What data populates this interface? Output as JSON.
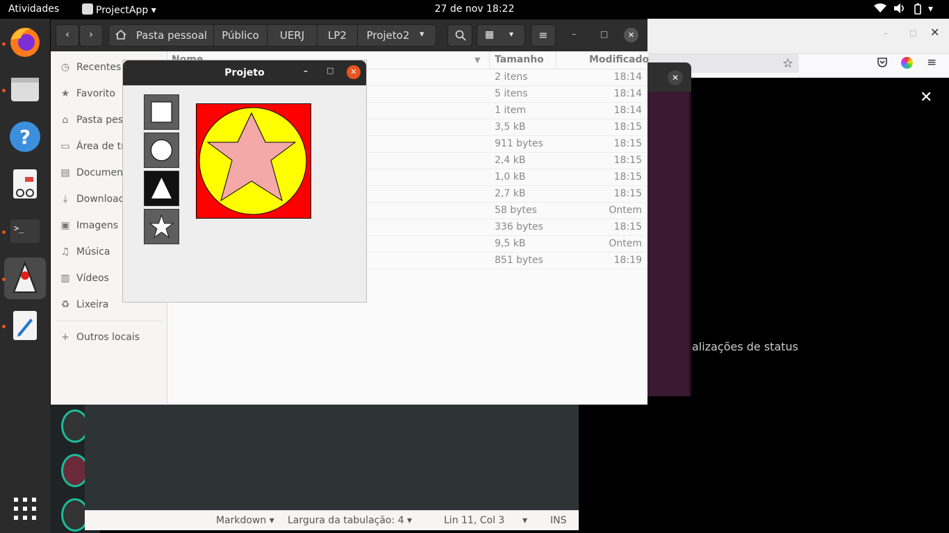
{
  "topbar": {
    "activities": "Atividades",
    "app_name": "ProjectApp",
    "clock": "27 de nov  18:22"
  },
  "file_manager": {
    "breadcrumbs": [
      "Pasta pessoal",
      "Público",
      "UERJ",
      "LP2",
      "Projeto2"
    ],
    "sidebar": [
      {
        "label": "Recentes",
        "icon": "clock-icon"
      },
      {
        "label": "Favorito",
        "icon": "star-icon"
      },
      {
        "label": "Pasta pes",
        "icon": "home-icon"
      },
      {
        "label": "Área de tr",
        "icon": "desktop-icon"
      },
      {
        "label": "Documen",
        "icon": "document-icon"
      },
      {
        "label": "Download",
        "icon": "download-icon"
      },
      {
        "label": "Imagens",
        "icon": "image-icon"
      },
      {
        "label": "Música",
        "icon": "music-icon"
      },
      {
        "label": "Vídeos",
        "icon": "video-icon"
      },
      {
        "label": "Lixeira",
        "icon": "trash-icon"
      },
      {
        "label": "Outros locais",
        "icon": "plus-icon"
      }
    ],
    "columns": {
      "name": "Nome",
      "size": "Tamanho",
      "modified": "Modificado"
    },
    "rows": [
      {
        "size": "2 itens",
        "modified": "18:14"
      },
      {
        "size": "5 itens",
        "modified": "18:14"
      },
      {
        "size": "1 item",
        "modified": "18:14"
      },
      {
        "size": "3,5 kB",
        "modified": "18:15"
      },
      {
        "size": "911 bytes",
        "modified": "18:15"
      },
      {
        "size": "2,4 kB",
        "modified": "18:15"
      },
      {
        "size": "1,0 kB",
        "modified": "18:15"
      },
      {
        "size": "2,7 kB",
        "modified": "18:15"
      },
      {
        "size": "58 bytes",
        "modified": "Ontem"
      },
      {
        "size": "336 bytes",
        "modified": "18:15"
      },
      {
        "size": "9,5 kB",
        "modified": "Ontem"
      },
      {
        "size": "851 bytes",
        "modified": "18:19"
      }
    ]
  },
  "projeto_window": {
    "title": "Projeto",
    "tools": [
      "square-tool",
      "circle-tool",
      "triangle-tool",
      "star-tool"
    ],
    "canvas_colors": {
      "background": "#ff0000",
      "circle": "#ffff00",
      "triangle": "#00dd00",
      "star": "#f4a8a8"
    }
  },
  "browser_background": {
    "status_text": "alizações de status"
  },
  "editor_statusbar": {
    "language": "Markdown",
    "tab_width": "Largura da tabulação: 4",
    "cursor": "Lin 11, Col 3",
    "mode": "INS"
  },
  "colors": {
    "accent": "#e95420"
  }
}
